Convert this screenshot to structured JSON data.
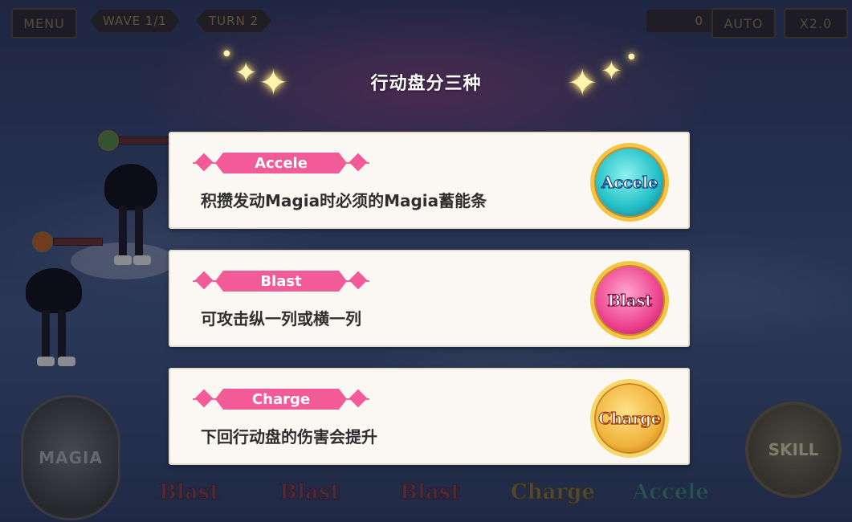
{
  "hud": {
    "menu_label": "MENU",
    "wave_label": "WAVE  1/1",
    "turn_label": "TURN   2",
    "counter_value": "0",
    "auto_label": "AUTO",
    "speed_label": "X2.0"
  },
  "dialog": {
    "title": "行动盘分三种",
    "cards": [
      {
        "name": "Accele",
        "description": "积攒发动Magia时必须的Magia蓄能条",
        "emblem_text": "Accele",
        "emblem_color": "#24c2c8"
      },
      {
        "name": "Blast",
        "description": "可攻击纵一列或横一列",
        "emblem_text": "Blast",
        "emblem_color": "#ec3f8c"
      },
      {
        "name": "Charge",
        "description": "下回行动盘的伤害会提升",
        "emblem_text": "Charge",
        "emblem_color": "#f0b23a"
      }
    ]
  },
  "bottom": {
    "magia_label": "MAGIA",
    "skill_label": "SKILL",
    "discs": [
      "Blast",
      "Blast",
      "Blast",
      "Charge",
      "Accele"
    ]
  },
  "colors": {
    "ribbon_pink": "#f25a98",
    "card_bg": "#fbf8f3"
  },
  "icons": [
    "sparkle-icon",
    "star-icon"
  ]
}
